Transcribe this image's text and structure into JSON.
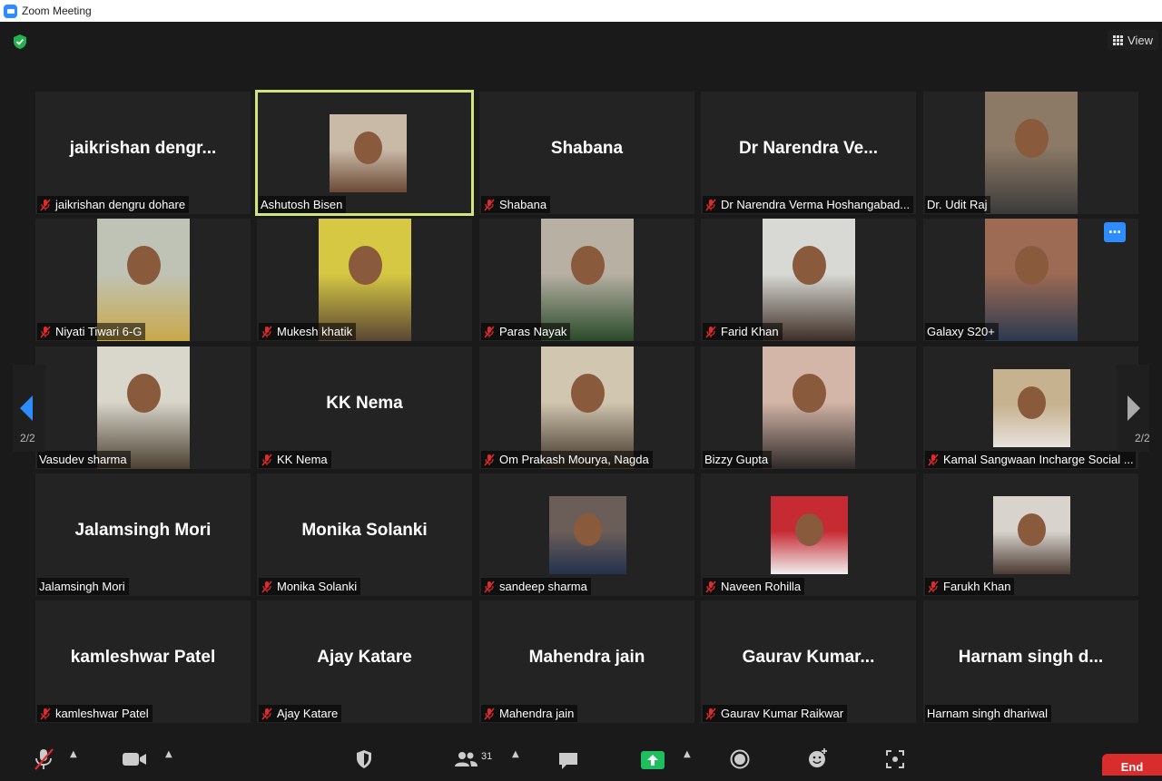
{
  "window": {
    "title": "Zoom Meeting"
  },
  "header": {
    "view_label": "View"
  },
  "pagination": {
    "left": "2/2",
    "right": "2/2"
  },
  "tiles": [
    {
      "big": "jaikrishan  dengr...",
      "label": "jaikrishan dengru dohare",
      "muted": true
    },
    {
      "big": "",
      "label": "Ashutosh Bisen",
      "muted": false,
      "active": true,
      "photo": true
    },
    {
      "big": "Shabana",
      "label": "Shabana",
      "muted": true
    },
    {
      "big": "Dr Narendra Ve...",
      "label": "Dr Narendra Verma Hoshangabad...",
      "muted": true
    },
    {
      "big": "",
      "label": "Dr. Udit Raj",
      "muted": false,
      "photo": true
    },
    {
      "big": "",
      "label": "Niyati Tiwari 6-G",
      "muted": true,
      "photo": true
    },
    {
      "big": "",
      "label": "Mukesh khatik",
      "muted": true,
      "photo": true
    },
    {
      "big": "",
      "label": "Paras Nayak",
      "muted": true,
      "photo": true
    },
    {
      "big": "",
      "label": "Farid Khan",
      "muted": true,
      "photo": true
    },
    {
      "big": "",
      "label": "Galaxy S20+",
      "muted": false,
      "photo": true,
      "more": true
    },
    {
      "big": "",
      "label": "Vasudev sharma",
      "muted": false,
      "photo": true
    },
    {
      "big": "KK Nema",
      "label": "KK Nema",
      "muted": true
    },
    {
      "big": "",
      "label": "Om Prakash Mourya, Nagda",
      "muted": true,
      "photo": true
    },
    {
      "big": "",
      "label": "Bizzy Gupta",
      "muted": false,
      "photo": true
    },
    {
      "big": "",
      "label": "Kamal Sangwaan Incharge Social ...",
      "muted": true,
      "photo": true
    },
    {
      "big": "Jalamsingh Mori",
      "label": "Jalamsingh Mori",
      "muted": false
    },
    {
      "big": "Monika Solanki",
      "label": "Monika Solanki",
      "muted": true
    },
    {
      "big": "",
      "label": "sandeep sharma",
      "muted": true,
      "photo": true
    },
    {
      "big": "",
      "label": "Naveen Rohilla",
      "muted": true,
      "photo": true
    },
    {
      "big": "",
      "label": "Farukh Khan",
      "muted": true,
      "photo": true
    },
    {
      "big": "kamleshwar Patel",
      "label": "kamleshwar Patel",
      "muted": true
    },
    {
      "big": "Ajay Katare",
      "label": "Ajay Katare",
      "muted": true
    },
    {
      "big": "Mahendra jain",
      "label": "Mahendra jain",
      "muted": true
    },
    {
      "big": "Gaurav  Kumar...",
      "label": "Gaurav Kumar Raikwar",
      "muted": true
    },
    {
      "big": "Harnam singh d...",
      "label": "Harnam singh dhariwal",
      "muted": false
    }
  ],
  "toolbar": {
    "participants_count": "31",
    "end_label": "End"
  },
  "colors": {
    "active_speaker_border": "#d0e67b",
    "mute_red": "#e02b2b",
    "accent_blue": "#2d8cff",
    "share_green": "#1fbf5f",
    "end_red": "#d92d2d"
  }
}
